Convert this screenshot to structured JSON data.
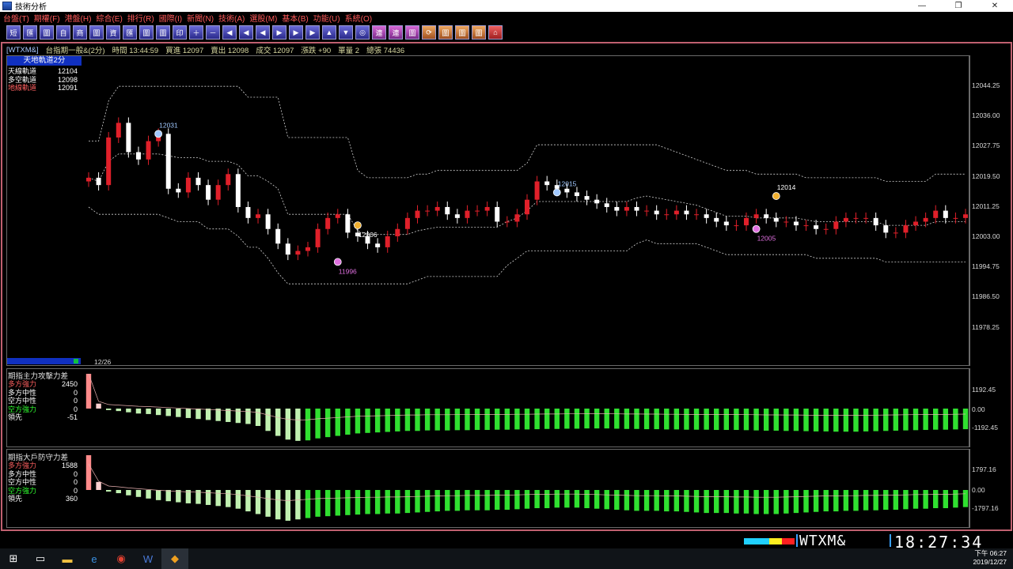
{
  "window": {
    "title": "技術分析",
    "min": "—",
    "max": "❐",
    "close": "✕"
  },
  "menu": [
    "台盤(T)",
    "期權(F)",
    "港盤(H)",
    "綜合(E)",
    "排行(R)",
    "國際(I)",
    "新聞(N)",
    "技術(A)",
    "選股(M)",
    "基本(B)",
    "功能(U)",
    "系統(O)"
  ],
  "toolbar": [
    "短",
    "匯",
    "圖",
    "自",
    "商",
    "圖",
    "資",
    "匯",
    "圖",
    "圖",
    "印",
    "＋",
    "－",
    "◀",
    "◀",
    "◀",
    "▶",
    "▶",
    "▶",
    "▲",
    "▼",
    "◎",
    "連",
    "連",
    "圖",
    "⟳",
    "圖",
    "圖",
    "圖",
    "⌂"
  ],
  "info": {
    "symbol": "[WTXM&]",
    "name": "台指期一般&(2分)",
    "time": "時間 13:44:59",
    "bid": "買進 12097",
    "ask": "賣出 12098",
    "deal": "成交 12097",
    "change": "漲跌 +90",
    "volume": "單量 2",
    "total": "總張 74436"
  },
  "legend_main": {
    "title": "天地軌道2分",
    "rows": [
      {
        "label": "天線軌道",
        "value": "12104",
        "color": "#ffffff"
      },
      {
        "label": "多空軌道",
        "value": "12098",
        "color": "#ffffff"
      },
      {
        "label": "地線軌道",
        "value": "12091",
        "color": "#ff6060"
      }
    ]
  },
  "legend_attack": {
    "title": "期指主力攻擊力差",
    "rows": [
      {
        "label": "多方強力",
        "value": "2450",
        "color": "#ff6060"
      },
      {
        "label": "多方中性",
        "value": "0",
        "color": "#ffffff"
      },
      {
        "label": "空方中性",
        "value": "0",
        "color": "#ffffff"
      },
      {
        "label": "空方強力",
        "value": "0",
        "color": "#30ff30"
      },
      {
        "label": "領先",
        "value": "-51",
        "color": "#ffffff"
      }
    ]
  },
  "legend_defense": {
    "title": "期指大戶防守力差",
    "rows": [
      {
        "label": "多方強力",
        "value": "1588",
        "color": "#ff6060"
      },
      {
        "label": "多方中性",
        "value": "0",
        "color": "#ffffff"
      },
      {
        "label": "空方中性",
        "value": "0",
        "color": "#ffffff"
      },
      {
        "label": "空方強力",
        "value": "0",
        "color": "#30ff30"
      },
      {
        "label": "領先",
        "value": "360",
        "color": "#ffffff"
      }
    ]
  },
  "axis_main": [
    "12044.25",
    "12036.00",
    "12027.75",
    "12019.50",
    "12011.25",
    "12003.00",
    "11994.75",
    "11986.50",
    "11978.25"
  ],
  "axis_attack": [
    "1192.45",
    "0.00",
    "-1192.45"
  ],
  "axis_defense": [
    "1797.16",
    "0.00",
    "-1797.16"
  ],
  "date_label": "12/26",
  "annotations": [
    {
      "label": "12031",
      "price": 12031,
      "kind": "high",
      "color": "#a0c8ff"
    },
    {
      "label": "12006",
      "price": 12006,
      "kind": "low-mark",
      "color": "#ffffff"
    },
    {
      "label": "11996",
      "price": 11996,
      "kind": "low",
      "color": "#e070e0"
    },
    {
      "label": "12015",
      "price": 12015,
      "kind": "high",
      "color": "#a0c8ff"
    },
    {
      "label": "12014",
      "price": 12014,
      "kind": "high-mark",
      "color": "#ffffff"
    },
    {
      "label": "12005",
      "price": 12005,
      "kind": "low",
      "color": "#e070e0"
    }
  ],
  "status": {
    "symbol": "WTXM&",
    "clock": "18:27:34"
  },
  "taskbar": {
    "time": "下午 06:27",
    "date": "2019/12/27"
  },
  "colors": {
    "up": "#e0202a",
    "down": "#ffffff",
    "bull_strong": "#ff8a8a",
    "bull_neutral": "#ffd0d0",
    "bear_neutral": "#c0f0b0",
    "bear_strong": "#30e030",
    "band": "#d0d0d0"
  },
  "chart_data": {
    "type": "candlestick",
    "panels": [
      "price",
      "attack_diff",
      "defense_diff"
    ],
    "y_range_price": [
      11978.25,
      12044.25
    ],
    "close_series": [
      12019,
      12017,
      12030,
      12034,
      12026,
      12024,
      12029,
      12031,
      12016,
      12015,
      12019,
      12017,
      12013,
      12017,
      12020,
      12011,
      12008,
      12009,
      12005,
      12001,
      11998,
      11999,
      12000,
      12005,
      12008,
      12009,
      12004,
      12003,
      12001,
      12000,
      12003,
      12005,
      12008,
      12010,
      12010,
      12011,
      12009,
      12008,
      12010,
      12010,
      12011,
      12007,
      12007,
      12009,
      12013,
      12018,
      12017,
      12016,
      12015,
      12014,
      12013,
      12012,
      12011,
      12010,
      12011,
      12010,
      12010,
      12009,
      12009,
      12010,
      12009,
      12009,
      12008,
      12007,
      12006,
      12006,
      12008,
      12009,
      12008,
      12007,
      12007,
      12006,
      12006,
      12005,
      12005,
      12007,
      12008,
      12008,
      12008,
      12006,
      12004,
      12004,
      12006,
      12007,
      12008,
      12010,
      12008,
      12008,
      12009
    ],
    "attack_series": [
      2450,
      200,
      -60,
      -100,
      -150,
      -200,
      -220,
      -260,
      -300,
      -340,
      -380,
      -420,
      -460,
      -500,
      -540,
      -580,
      -620,
      -700,
      -900,
      -1100,
      -1250,
      -1300,
      -1280,
      -1200,
      -1150,
      -1100,
      -1050,
      -1000,
      -980,
      -960,
      -940,
      -920,
      -900,
      -900,
      -880,
      -880,
      -880,
      -870,
      -870,
      -860,
      -860,
      -850,
      -850,
      -840,
      -840,
      -830,
      -820,
      -820,
      -810,
      -810,
      -800,
      -800,
      -800,
      -810,
      -820,
      -820,
      -830,
      -830,
      -840,
      -840,
      -850,
      -850,
      -850,
      -860,
      -860,
      -860,
      -870,
      -880,
      -890,
      -890,
      -900,
      -900,
      -910,
      -920,
      -920,
      -930,
      -930,
      -930,
      -920,
      -910,
      -900,
      -890,
      -880,
      -870,
      -860,
      -850,
      -850,
      -840,
      -830
    ],
    "defense_series": [
      1588,
      300,
      -60,
      -120,
      -200,
      -260,
      -320,
      -380,
      -420,
      -460,
      -500,
      -520,
      -560,
      -600,
      -640,
      -700,
      -800,
      -900,
      -1000,
      -1100,
      -1150,
      -1100,
      -1050,
      -1000,
      -980,
      -960,
      -940,
      -920,
      -900,
      -900,
      -880,
      -880,
      -860,
      -840,
      -820,
      -800,
      -780,
      -780,
      -760,
      -760,
      -760,
      -740,
      -740,
      -720,
      -700,
      -680,
      -680,
      -660,
      -660,
      -660,
      -680,
      -700,
      -720,
      -740,
      -760,
      -780,
      -780,
      -780,
      -800,
      -800,
      -820,
      -840,
      -860,
      -860,
      -860,
      -880,
      -880,
      -900,
      -900,
      -900,
      -880,
      -860,
      -840,
      -820,
      -800,
      -800,
      -780,
      -780,
      -760,
      -760,
      -740,
      -740,
      -720,
      -700,
      -700,
      -680,
      -680,
      -660,
      -640
    ]
  }
}
